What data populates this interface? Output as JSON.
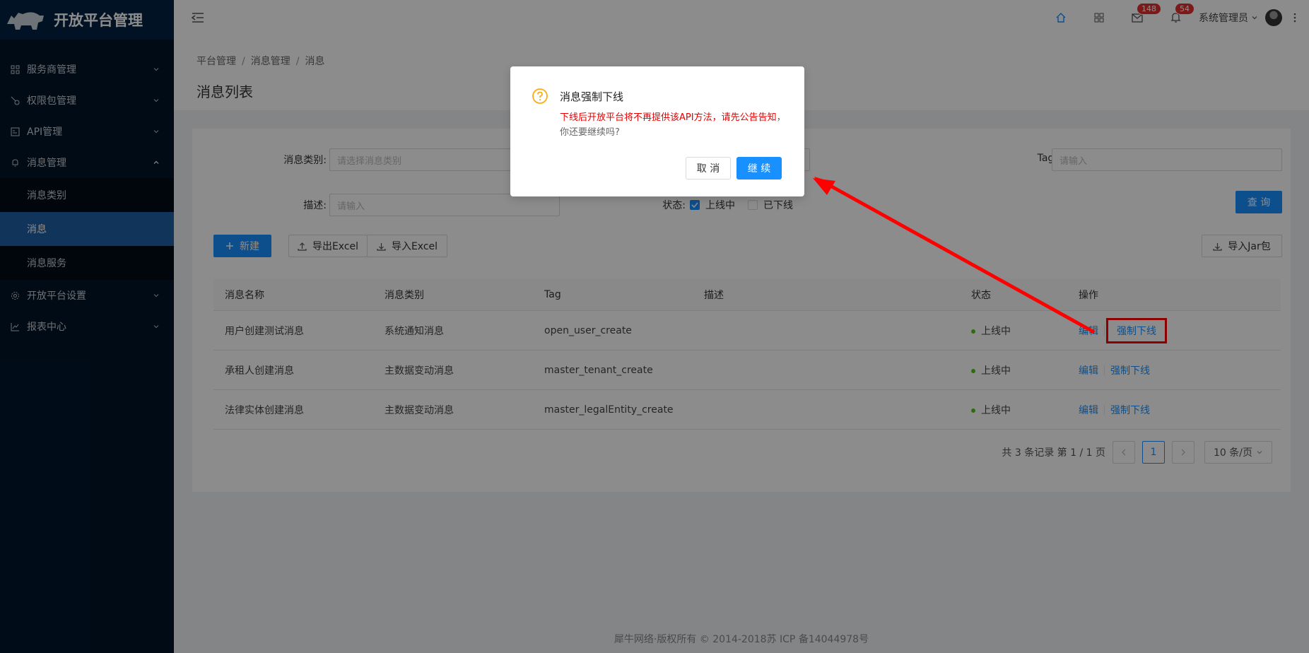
{
  "app": {
    "title": "开放平台管理"
  },
  "sidebar": {
    "items": [
      {
        "label": "服务商管理",
        "icon": "team-icon"
      },
      {
        "label": "权限包管理",
        "icon": "key-icon"
      },
      {
        "label": "API管理",
        "icon": "api-icon"
      },
      {
        "label": "消息管理",
        "icon": "bell-icon",
        "open": true,
        "children": [
          {
            "label": "消息类别"
          },
          {
            "label": "消息",
            "active": true
          },
          {
            "label": "消息服务"
          }
        ]
      },
      {
        "label": "开放平台设置",
        "icon": "gear-icon"
      },
      {
        "label": "报表中心",
        "icon": "chart-icon"
      }
    ]
  },
  "header": {
    "mail_badge": "148",
    "notice_badge": "54",
    "user_name": "系统管理员"
  },
  "breadcrumb": [
    "平台管理",
    "消息管理",
    "消息"
  ],
  "page_title": "消息列表",
  "form": {
    "category_label": "消息类别:",
    "category_placeholder": "请选择消息类别",
    "tag_label": "Tag:",
    "tag_placeholder": "请输入",
    "desc_label": "描述:",
    "desc_placeholder": "请输入",
    "status_label": "状态:",
    "status_online": "上线中",
    "status_offline": "已下线",
    "online_checked": true,
    "offline_checked": false,
    "query_button": "查 询"
  },
  "toolbar": {
    "new_button": "新建",
    "export_button": "导出Excel",
    "import_button": "导入Excel",
    "import_jar_button": "导入Jar包"
  },
  "table": {
    "columns": [
      "消息名称",
      "消息类别",
      "Tag",
      "描述",
      "状态",
      "操作"
    ],
    "rows": [
      {
        "name": "用户创建测试消息",
        "category": "系统通知消息",
        "tag": "open_user_create",
        "desc": "",
        "status": "上线中",
        "edit": "编辑",
        "offline": "强制下线"
      },
      {
        "name": "承租人创建消息",
        "category": "主数据变动消息",
        "tag": "master_tenant_create",
        "desc": "",
        "status": "上线中",
        "edit": "编辑",
        "offline": "强制下线"
      },
      {
        "name": "法律实体创建消息",
        "category": "主数据变动消息",
        "tag": "master_legalEntity_create",
        "desc": "",
        "status": "上线中",
        "edit": "编辑",
        "offline": "强制下线"
      }
    ]
  },
  "pagination": {
    "summary": "共 3 条记录 第 1 / 1 页",
    "current": "1",
    "page_size": "10 条/页"
  },
  "footer": "犀牛网络·版权所有 © 2014-2018苏 ICP 备14044978号",
  "modal": {
    "title": "消息强制下线",
    "warning": "下线后开放平台将不再提供该API方法，请先公告告知",
    "question": "，你还要继续吗?",
    "cancel": "取 消",
    "ok": "继 续"
  },
  "colors": {
    "primary": "#1890ff",
    "sidebar": "#001529",
    "warning_text": "#e60000",
    "annotation_red": "#ff0000"
  }
}
